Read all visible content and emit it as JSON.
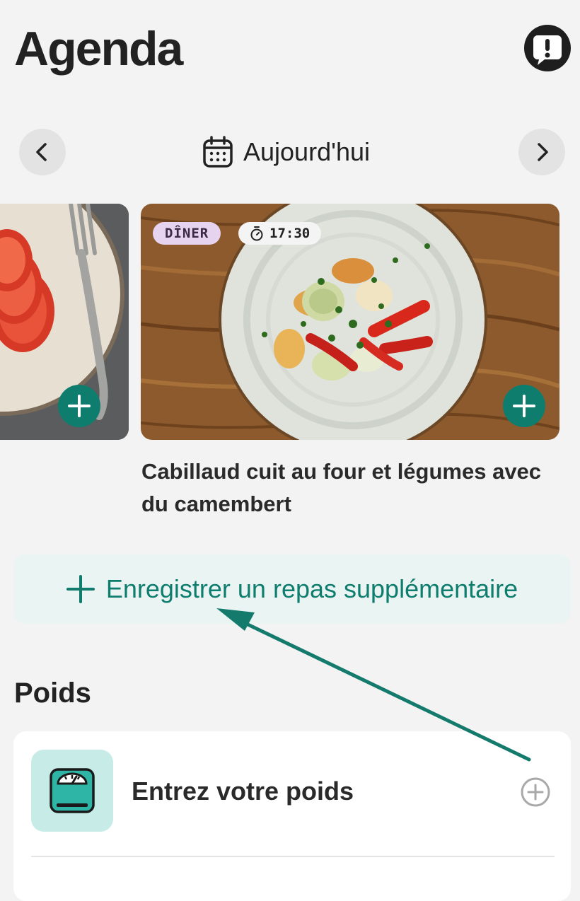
{
  "header": {
    "title": "Agenda"
  },
  "date_nav": {
    "label": "Aujourd'hui"
  },
  "meals": [
    {
      "tag": "DÎNER",
      "time": "17:30",
      "title": "Cabillaud cuit au four et légumes avec du camembert"
    }
  ],
  "extra_meal": {
    "label": "Enregistrer un repas supplémentaire"
  },
  "weight_section": {
    "title": "Poids",
    "entry_label": "Entrez votre poids"
  },
  "colors": {
    "accent": "#0f7d6e",
    "background": "#f3f3f3",
    "tag_meal": "#e6d3f0"
  },
  "icons": {
    "feedback": "feedback-icon",
    "prev": "chevron-left-icon",
    "next": "chevron-right-icon",
    "calendar": "calendar-icon",
    "add": "plus-icon",
    "timer": "stopwatch-icon",
    "scale": "scale-icon",
    "add_circle": "plus-circle-icon"
  }
}
